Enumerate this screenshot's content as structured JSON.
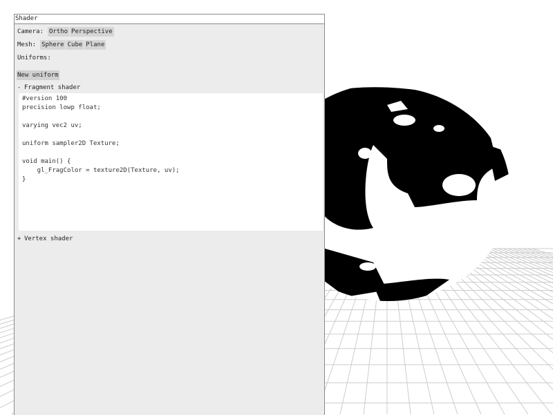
{
  "panel": {
    "title": "Shader",
    "camera": {
      "label": "Camera:",
      "options": [
        "Ortho",
        "Perspective"
      ]
    },
    "mesh": {
      "label": "Mesh:",
      "options": [
        "Sphere",
        "Cube",
        "Plane"
      ]
    },
    "uniforms_label": "Uniforms:",
    "new_uniform_label": "New uniform",
    "fragment_shader": {
      "toggle": "-",
      "label": "Fragment shader",
      "code": "#version 100\nprecision lowp float;\n\nvarying vec2 uv;\n\nuniform sampler2D Texture;\n\nvoid main() {\n    gl_FragColor = texture2D(Texture, uv);\n}"
    },
    "vertex_shader": {
      "toggle": "+",
      "label": "Vertex shader"
    }
  },
  "viewport": {
    "mesh": "sphere",
    "background_color": "#ffffff",
    "grid_color": "#cccccc",
    "mesh_dark_color": "#000000",
    "mesh_light_color": "#ffffff"
  }
}
